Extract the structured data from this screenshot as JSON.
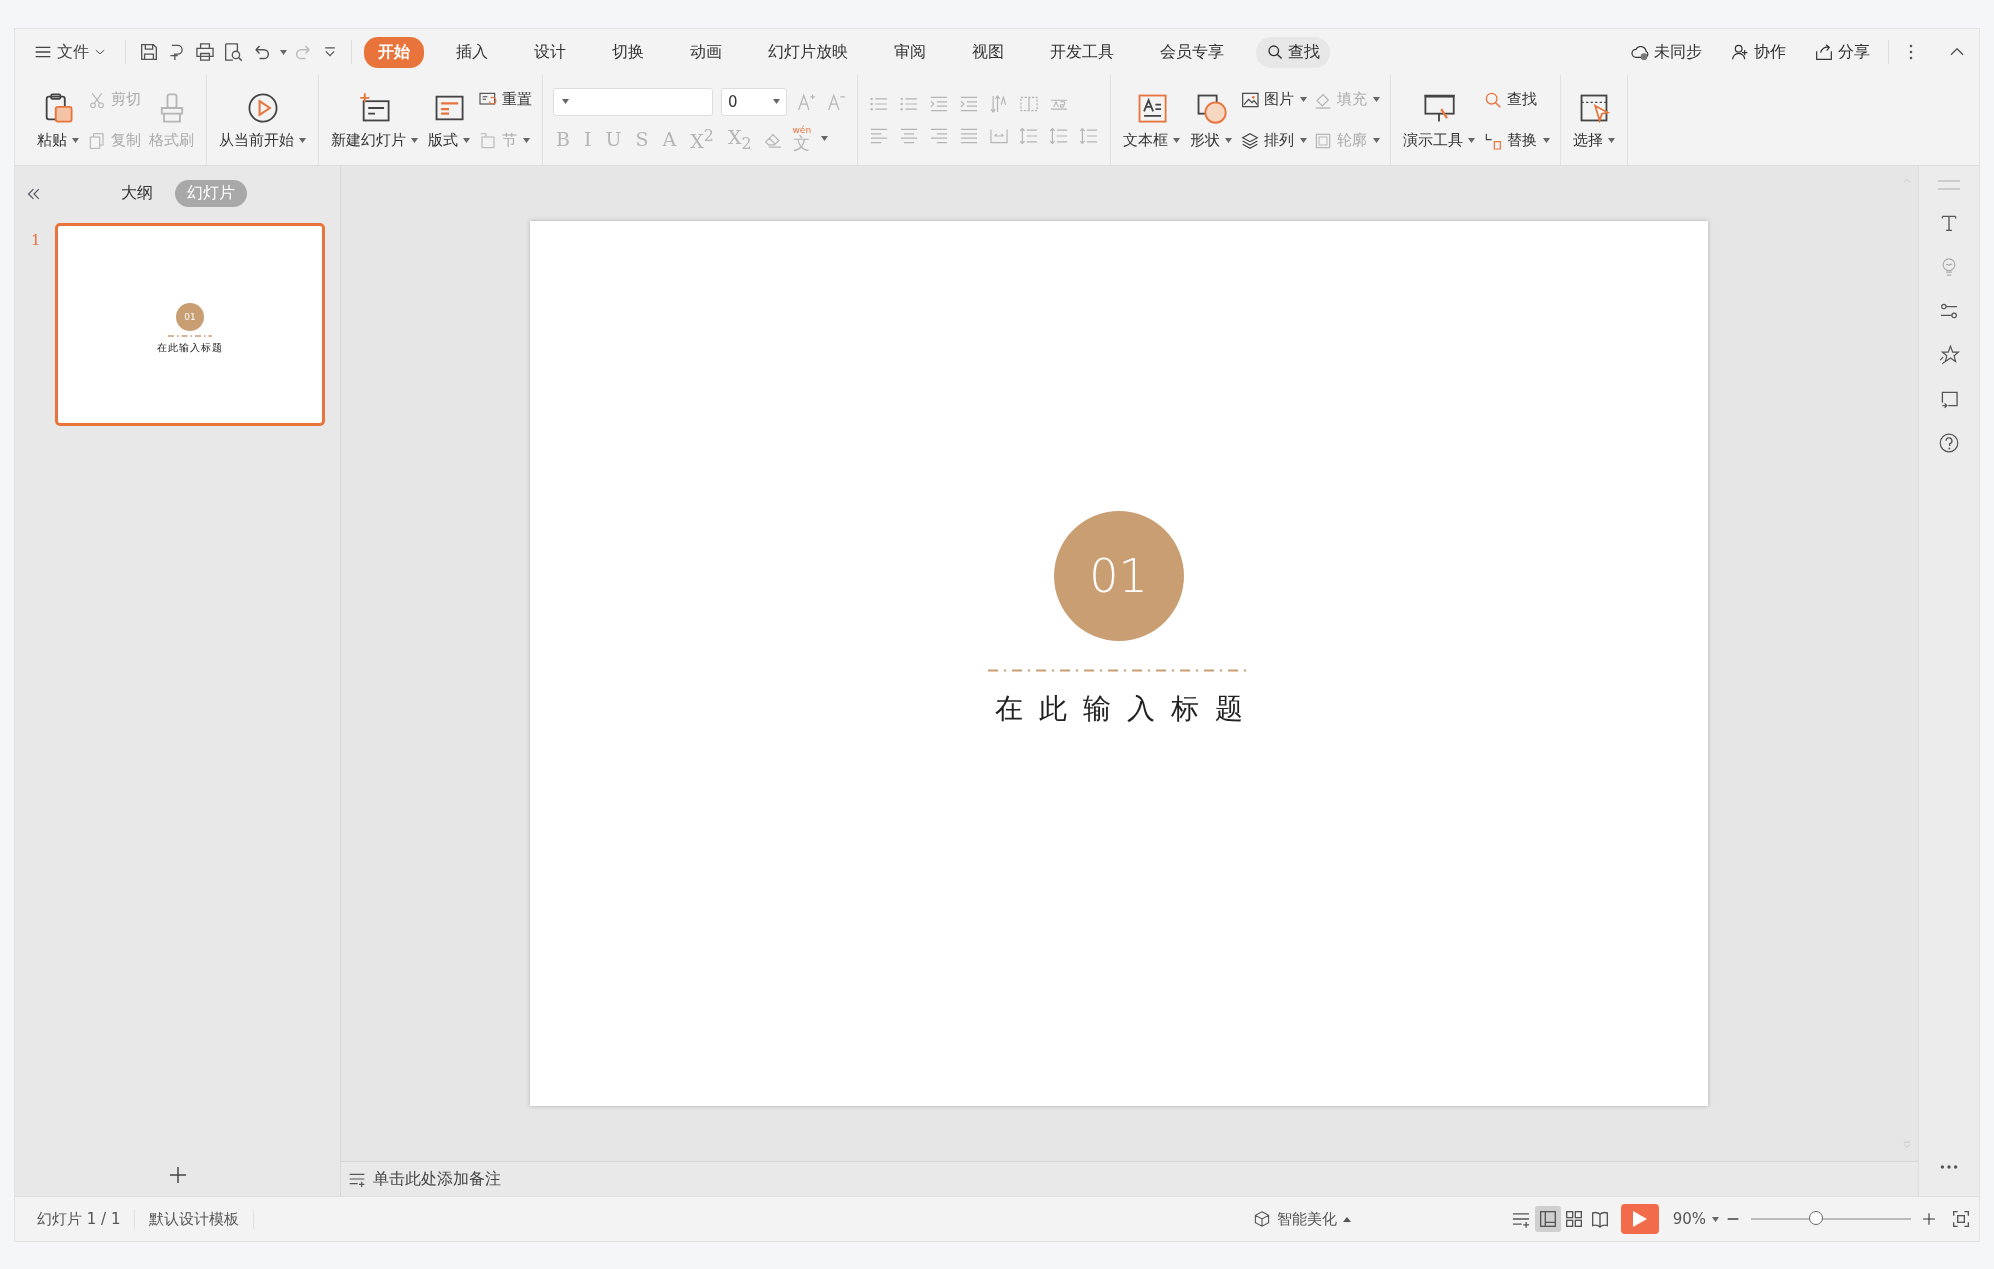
{
  "menu_bar": {
    "file_menu": "文件",
    "tabs": [
      {
        "label": "开始",
        "selected": true
      },
      {
        "label": "插入",
        "selected": false
      },
      {
        "label": "设计",
        "selected": false
      },
      {
        "label": "切换",
        "selected": false
      },
      {
        "label": "动画",
        "selected": false
      },
      {
        "label": "幻灯片放映",
        "selected": false
      },
      {
        "label": "审阅",
        "selected": false
      },
      {
        "label": "视图",
        "selected": false
      },
      {
        "label": "开发工具",
        "selected": false
      },
      {
        "label": "会员专享",
        "selected": false
      }
    ],
    "search": "查找",
    "actions": [
      {
        "label": "未同步"
      },
      {
        "label": "协作"
      },
      {
        "label": "分享"
      }
    ]
  },
  "ribbon": [
    {
      "kind": "buttons",
      "items": [
        {
          "kind": "large",
          "label": "粘贴",
          "disabled": false,
          "dropdown": true
        },
        {
          "kind": "small",
          "label": "剪切",
          "disabled": true,
          "dropdown": false
        },
        {
          "kind": "small",
          "label": "复制",
          "disabled": true,
          "dropdown": false
        },
        {
          "kind": "large",
          "label": "格式刷",
          "disabled": true,
          "dropdown": false
        }
      ]
    },
    {
      "kind": "buttons",
      "items": [
        {
          "kind": "large",
          "label": "从当前开始",
          "disabled": false,
          "dropdown": true
        }
      ]
    },
    {
      "kind": "buttons",
      "items": [
        {
          "kind": "large",
          "label": "新建幻灯片",
          "disabled": false,
          "dropdown": true
        },
        {
          "kind": "large",
          "label": "版式",
          "disabled": false,
          "dropdown": true
        },
        {
          "kind": "small",
          "label": "重置",
          "disabled": false,
          "dropdown": false
        },
        {
          "kind": "small",
          "label": "节",
          "disabled": true,
          "dropdown": true
        }
      ]
    },
    {
      "kind": "font",
      "size": "0",
      "format_buttons": [
        {
          "label": "B",
          "disabled": true
        },
        {
          "label": "I",
          "disabled": true
        },
        {
          "label": "U",
          "disabled": true
        },
        {
          "label": "S",
          "disabled": true
        },
        {
          "label": "A",
          "disabled": true
        },
        {
          "label": "X$^{2}$",
          "disabled": true
        },
        {
          "label": "X$_{2}$",
          "disabled": true
        }
      ],
      "phonetic": {
        "label": "文",
        "ruby": "wén"
      }
    },
    {
      "kind": "paragraph"
    },
    {
      "kind": "buttons",
      "items": [
        {
          "kind": "large",
          "label": "文本框",
          "disabled": false,
          "dropdown": true
        },
        {
          "kind": "large",
          "label": "形状",
          "disabled": false,
          "dropdown": true
        },
        {
          "kind": "small",
          "label": "图片",
          "disabled": false,
          "dropdown": true
        },
        {
          "kind": "small",
          "label": "排列",
          "disabled": false,
          "dropdown": true
        },
        {
          "kind": "small",
          "label": "填充",
          "disabled": true,
          "dropdown": true
        },
        {
          "kind": "small",
          "label": "轮廓",
          "disabled": true,
          "dropdown": true
        }
      ]
    },
    {
      "kind": "buttons",
      "items": [
        {
          "kind": "large",
          "label": "演示工具",
          "disabled": false,
          "dropdown": true
        },
        {
          "kind": "small",
          "label": "查找",
          "disabled": false,
          "dropdown": false
        },
        {
          "kind": "small",
          "label": "替换",
          "disabled": false,
          "dropdown": true
        }
      ]
    },
    {
      "kind": "buttons",
      "items": [
        {
          "kind": "large",
          "label": "选择",
          "disabled": false,
          "dropdown": true
        }
      ]
    }
  ],
  "panel": {
    "tabs": [
      {
        "label": "大纲",
        "selected": false
      },
      {
        "label": "幻灯片",
        "selected": true
      }
    ],
    "thumbnails": [
      {
        "index": "1",
        "selected": true,
        "number": "01",
        "title": "在此输入标题"
      }
    ]
  },
  "slide": {
    "number": "01",
    "title": "在此输入标题"
  },
  "notes": {
    "placeholder": "单击此处添加备注"
  },
  "status_bar": {
    "slide_count": "幻灯片 1 / 1",
    "template": "默认设计模板",
    "beautify": "智能美化",
    "zoom": "90%",
    "zoom_slider": {
      "level": 0.4
    }
  }
}
